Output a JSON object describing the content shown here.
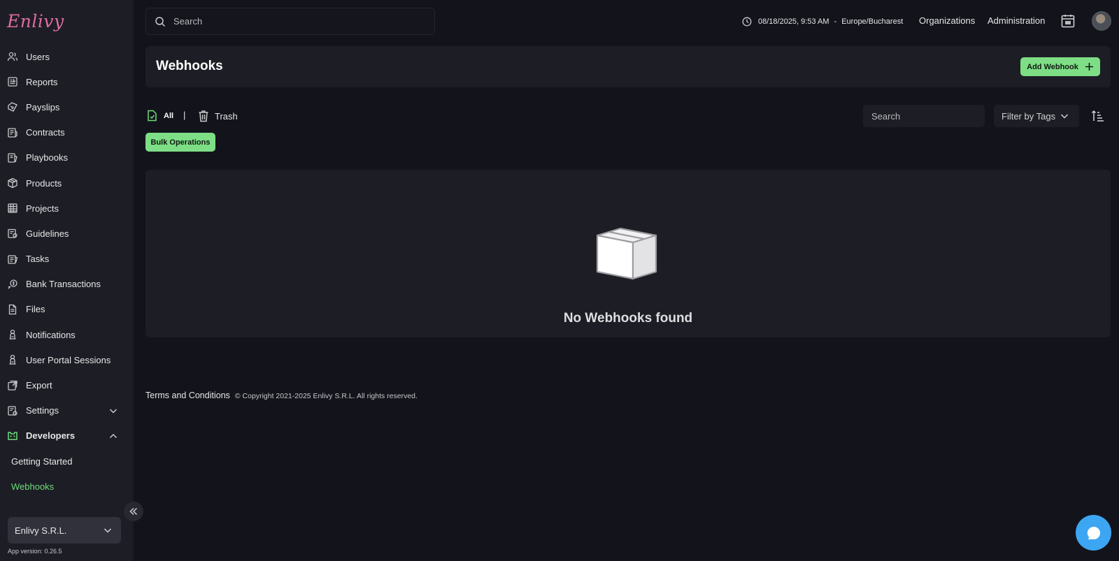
{
  "app": {
    "logo_text": "Enlivy"
  },
  "sidebar": {
    "items": [
      {
        "label": "Users",
        "icon": "users-icon"
      },
      {
        "label": "Reports",
        "icon": "reports-icon"
      },
      {
        "label": "Payslips",
        "icon": "payslips-icon"
      },
      {
        "label": "Contracts",
        "icon": "contracts-icon"
      },
      {
        "label": "Playbooks",
        "icon": "playbooks-icon"
      },
      {
        "label": "Products",
        "icon": "products-icon"
      },
      {
        "label": "Projects",
        "icon": "projects-icon"
      },
      {
        "label": "Guidelines",
        "icon": "guidelines-icon"
      },
      {
        "label": "Tasks",
        "icon": "tasks-icon"
      },
      {
        "label": "Bank Transactions",
        "icon": "bank-icon"
      },
      {
        "label": "Files",
        "icon": "file-icon"
      },
      {
        "label": "Notifications",
        "icon": "notifications-icon"
      },
      {
        "label": "User Portal Sessions",
        "icon": "portal-sessions-icon"
      },
      {
        "label": "Export",
        "icon": "export-icon"
      },
      {
        "label": "Settings",
        "icon": "settings-icon"
      },
      {
        "label": "Developers",
        "icon": "developers-icon"
      }
    ],
    "developers_sub": [
      "Getting Started",
      "Webhooks"
    ],
    "organization": "Enlivy S.R.L.",
    "app_version": "App version: 0.26.5"
  },
  "topbar": {
    "search_placeholder": "Search",
    "datetime": "08/18/2025, 9:53 AM",
    "separator": "-",
    "timezone": "Europe/Bucharest",
    "organizations": "Organizations",
    "administration": "Administration"
  },
  "page": {
    "title": "Webhooks",
    "add_button": "Add Webhook",
    "filter_all": "All",
    "filter_separator": "|",
    "filter_trash": "Trash",
    "bulk_operations": "Bulk Operations",
    "list_search_placeholder": "Search",
    "tag_filter": "Filter by Tags",
    "empty_message": "No Webhooks found"
  },
  "footer": {
    "terms": "Terms and Conditions",
    "copyright": "© Copyright 2021-2025 Enlivy S.R.L. All rights reserved."
  },
  "colors": {
    "accent_green": "#7ede86",
    "background": "#13141b",
    "panel": "#1d1e25",
    "chat_blue": "#3da6f2"
  }
}
